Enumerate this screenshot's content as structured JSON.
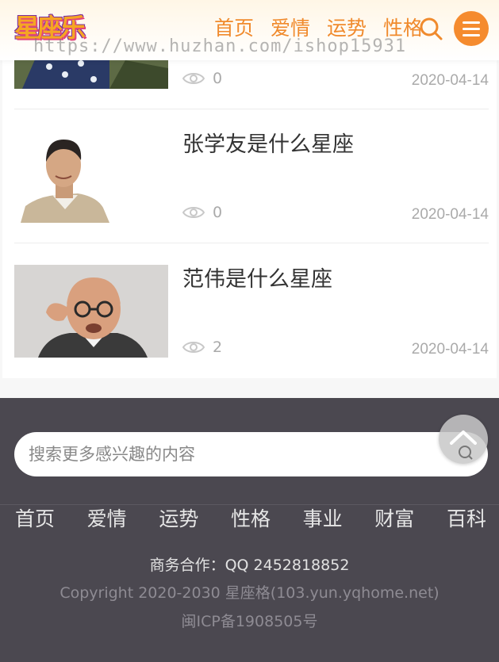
{
  "header": {
    "logo_text": "星座乐",
    "nav": [
      "首页",
      "爱情",
      "运势",
      "性格"
    ],
    "watermark": "https://www.huzhan.com/ishop15931"
  },
  "articles": [
    {
      "title": "",
      "views": "0",
      "date": "2020-04-14"
    },
    {
      "title": "张学友是什么星座",
      "views": "0",
      "date": "2020-04-14"
    },
    {
      "title": "范伟是什么星座",
      "views": "2",
      "date": "2020-04-14"
    }
  ],
  "footer": {
    "search_placeholder": "搜索更多感兴趣的内容",
    "nav": [
      "首页",
      "爱情",
      "运势",
      "性格",
      "事业",
      "财富",
      "百科"
    ],
    "business": "商务合作：QQ 2452818852",
    "copyright": "Copyright 2020-2030 星座格(103.yun.yqhome.net)",
    "icp": "闽ICP备1908505号"
  },
  "colors": {
    "accent": "#f08a2c",
    "footer_bg": "#4b4850"
  }
}
